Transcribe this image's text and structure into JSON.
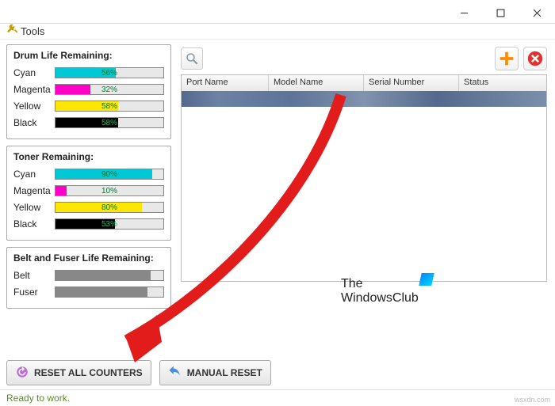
{
  "window": {
    "tools_label": "Tools"
  },
  "panels": {
    "drum": {
      "title": "Drum Life Remaining:",
      "items": [
        {
          "label": "Cyan",
          "pct": 56,
          "color": "#00c8d7",
          "text": "56%"
        },
        {
          "label": "Magenta",
          "pct": 32,
          "color": "#ff00c8",
          "text": "32%"
        },
        {
          "label": "Yellow",
          "pct": 58,
          "color": "#ffe600",
          "text": "58%"
        },
        {
          "label": "Black",
          "pct": 58,
          "color": "#000000",
          "text": "58%",
          "textcolor": "#00c26a"
        }
      ]
    },
    "toner": {
      "title": "Toner Remaining:",
      "items": [
        {
          "label": "Cyan",
          "pct": 90,
          "color": "#00c8d7",
          "text": "90%"
        },
        {
          "label": "Magenta",
          "pct": 10,
          "color": "#ff00c8",
          "text": "10%",
          "textcolor": "#073"
        },
        {
          "label": "Yellow",
          "pct": 80,
          "color": "#ffe600",
          "text": "80%"
        },
        {
          "label": "Black",
          "pct": 55,
          "color": "#000000",
          "text": "53%",
          "textcolor": "#00c26a"
        }
      ]
    },
    "belt": {
      "title": "Belt and Fuser Life Remaining:",
      "items": [
        {
          "label": "Belt",
          "pct": 88,
          "color": "#888",
          "text": " "
        },
        {
          "label": "Fuser",
          "pct": 85,
          "color": "#888",
          "text": " "
        }
      ]
    }
  },
  "table": {
    "columns": [
      "Port Name",
      "Model Name",
      "Serial Number",
      "Status"
    ]
  },
  "buttons": {
    "reset_all": "RESET ALL COUNTERS",
    "manual_reset": "MANUAL RESET"
  },
  "status": "Ready to work.",
  "watermark": {
    "line1": "The",
    "line2": "WindowsClub"
  },
  "sitemark": "wsxdn.com"
}
